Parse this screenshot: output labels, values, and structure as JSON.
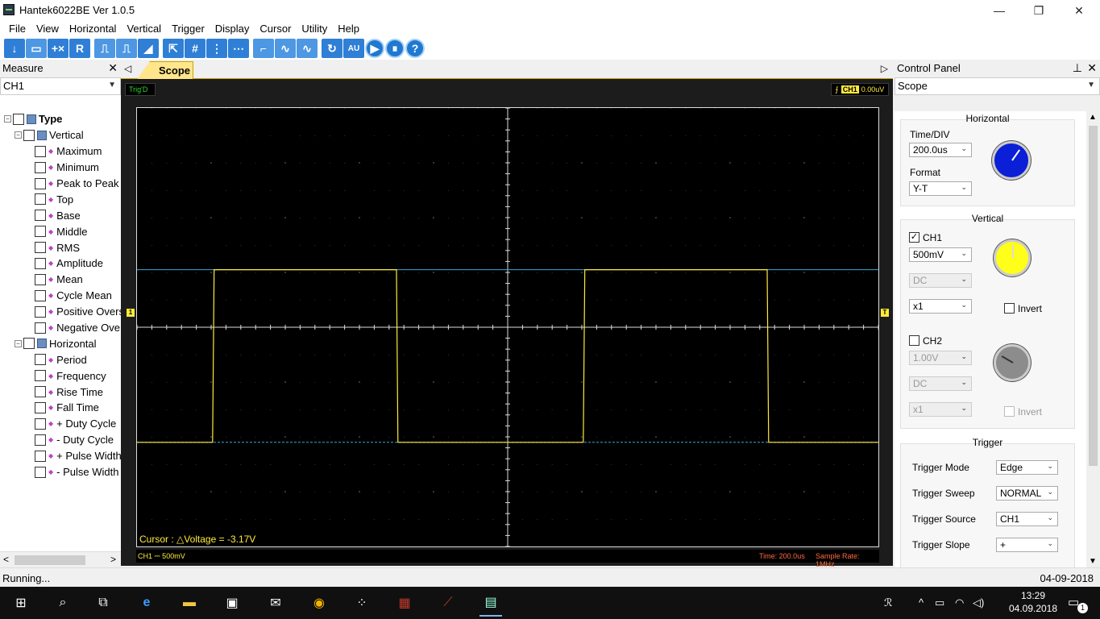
{
  "window": {
    "title": "Hantek6022BE Ver 1.0.5",
    "minimize": "—",
    "maximize": "❐",
    "close": "✕"
  },
  "menu": [
    "File",
    "View",
    "Horizontal",
    "Vertical",
    "Trigger",
    "Display",
    "Cursor",
    "Utility",
    "Help"
  ],
  "toolbar_glyphs": [
    "↓",
    "▭",
    "+×",
    "R",
    "⎍",
    "⎍",
    "◢",
    "⇱",
    "#",
    "⋮",
    "⋯",
    "⌐",
    "∿",
    "∿",
    "↻",
    "AU",
    "▶",
    "⏸",
    "?"
  ],
  "measure": {
    "title": "Measure",
    "channel": "CH1",
    "tree": {
      "root": "Type",
      "vertical": {
        "label": "Vertical",
        "items": [
          "Maximum",
          "Minimum",
          "Peak to Peak",
          "Top",
          "Base",
          "Middle",
          "RMS",
          "Amplitude",
          "Mean",
          "Cycle Mean",
          "Positive Overs",
          "Negative Ove"
        ]
      },
      "horizontal": {
        "label": "Horizontal",
        "items": [
          "Period",
          "Frequency",
          "Rise Time",
          "Fall Time",
          "+ Duty Cycle",
          "- Duty Cycle",
          "+ Pulse Width",
          "- Pulse Width"
        ]
      }
    }
  },
  "scope": {
    "tab": "Scope",
    "trig_status": "Trig'D",
    "trig_channel": "CH1",
    "trig_level": "0.00uV",
    "cursor_readout": "Cursor : △Voltage = -3.17V",
    "ch_marker": "1",
    "trig_marker": "T",
    "ch_scale": "CH1 ⎓  500mV",
    "time": "Time: 200.0us",
    "sample_rate": "Sample Rate: 1MHz",
    "colors": {
      "ch1": "#ffeb3b",
      "levels": "#3aa7d6"
    }
  },
  "chart_data": {
    "type": "line",
    "title": "",
    "xlabel": "",
    "ylabel": "",
    "xlim": [
      0,
      10
    ],
    "ylim": [
      -4,
      4
    ],
    "grid": true,
    "series": [
      {
        "x": [
          0,
          1.02,
          1.04,
          3.5,
          3.52,
          6.02,
          6.04,
          8.5,
          8.52,
          10
        ],
        "y": [
          -2.1,
          -2.1,
          1.05,
          1.05,
          -2.1,
          -2.1,
          1.05,
          1.05,
          -2.1,
          -2.1
        ]
      }
    ],
    "reference_lines": [
      1.05,
      -2.1
    ]
  },
  "control": {
    "title": "Control Panel",
    "mode": "Scope",
    "horizontal": {
      "title": "Horizontal",
      "timediv_label": "Time/DIV",
      "timediv": "200.0us",
      "format_label": "Format",
      "format": "Y-T"
    },
    "vertical": {
      "title": "Vertical",
      "ch1": {
        "label": "CH1",
        "checked": "✓",
        "volts": "500mV",
        "coupling": "DC",
        "probe": "x1",
        "invert": "Invert"
      },
      "ch2": {
        "label": "CH2",
        "volts": "1.00V",
        "coupling": "DC",
        "probe": "x1",
        "invert": "Invert"
      }
    },
    "trigger": {
      "title": "Trigger",
      "mode_label": "Trigger Mode",
      "mode": "Edge",
      "sweep_label": "Trigger Sweep",
      "sweep": "NORMAL",
      "source_label": "Trigger Source",
      "source": "CH1",
      "slope_label": "Trigger Slope",
      "slope": "+"
    },
    "knob_colors": {
      "horizontal": "#0a1fd6",
      "ch1": "#ffff1a",
      "ch2": "#8c8c8c"
    }
  },
  "status": {
    "left": "Running...",
    "right": "04-09-2018"
  },
  "taskbar": {
    "time": "13:29",
    "date": "04.09.2018",
    "notifications": "1"
  }
}
